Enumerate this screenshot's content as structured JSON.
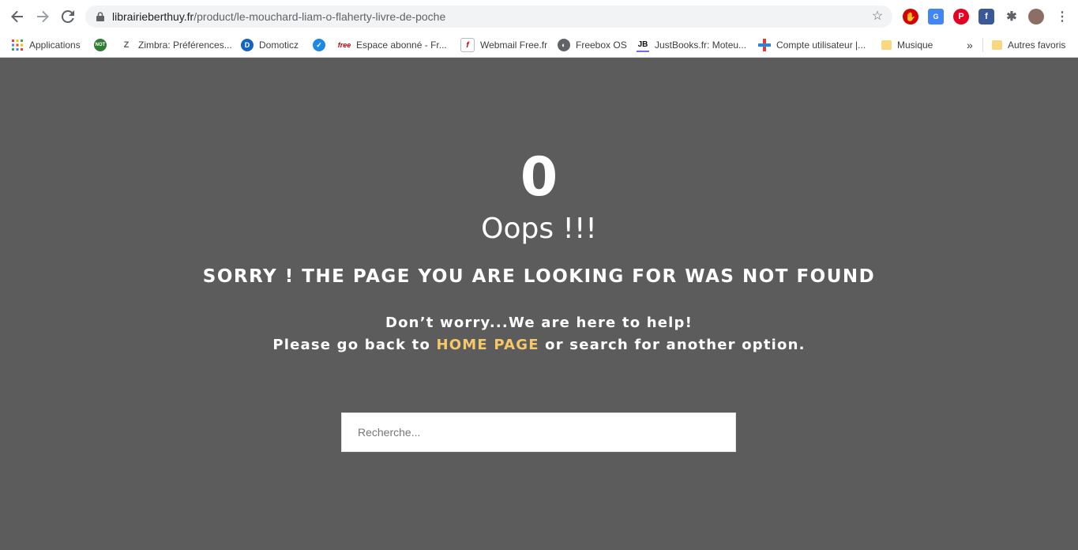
{
  "browser": {
    "url_domain": "librairieberthuy.fr",
    "url_path": "/product/le-mouchard-liam-o-flaherty-livre-de-poche"
  },
  "bookmarks": {
    "items": [
      {
        "label": "Applications",
        "icon": "apps-grid-icon"
      },
      {
        "label": "",
        "icon": "not-icon",
        "icon_text": "NOT"
      },
      {
        "label": "Zimbra: Préférences...",
        "icon": "zimbra-icon"
      },
      {
        "label": "Domoticz",
        "icon": "domoticz-icon"
      },
      {
        "label": "",
        "icon": "vpn-icon"
      },
      {
        "label": "Espace abonné - Fr...",
        "icon": "free-icon",
        "icon_text": "free"
      },
      {
        "label": "Webmail Free.fr",
        "icon": "webmail-icon"
      },
      {
        "label": "Freebox OS",
        "icon": "globe-icon"
      },
      {
        "label": "JustBooks.fr: Moteu...",
        "icon": "justbooks-icon",
        "icon_text": "JB"
      },
      {
        "label": "Compte utilisateur |...",
        "icon": "compte-icon"
      },
      {
        "label": "Musique",
        "icon": "folder-icon"
      }
    ],
    "overflow": "»",
    "other": "Autres favoris"
  },
  "page": {
    "code": "0",
    "oops": "Oops !!!",
    "headline": "SORRY ! THE PAGE YOU ARE LOOKING FOR WAS NOT FOUND",
    "help_line1": "Don’t worry...We are here to help!",
    "help_line2_before": "Please go back to ",
    "home_link": "HOME PAGE",
    "help_line2_after": " or search for another option.",
    "search_placeholder": "Recherche..."
  },
  "colors": {
    "page_bg": "#5c5c5c",
    "link": "#f5c86a"
  }
}
